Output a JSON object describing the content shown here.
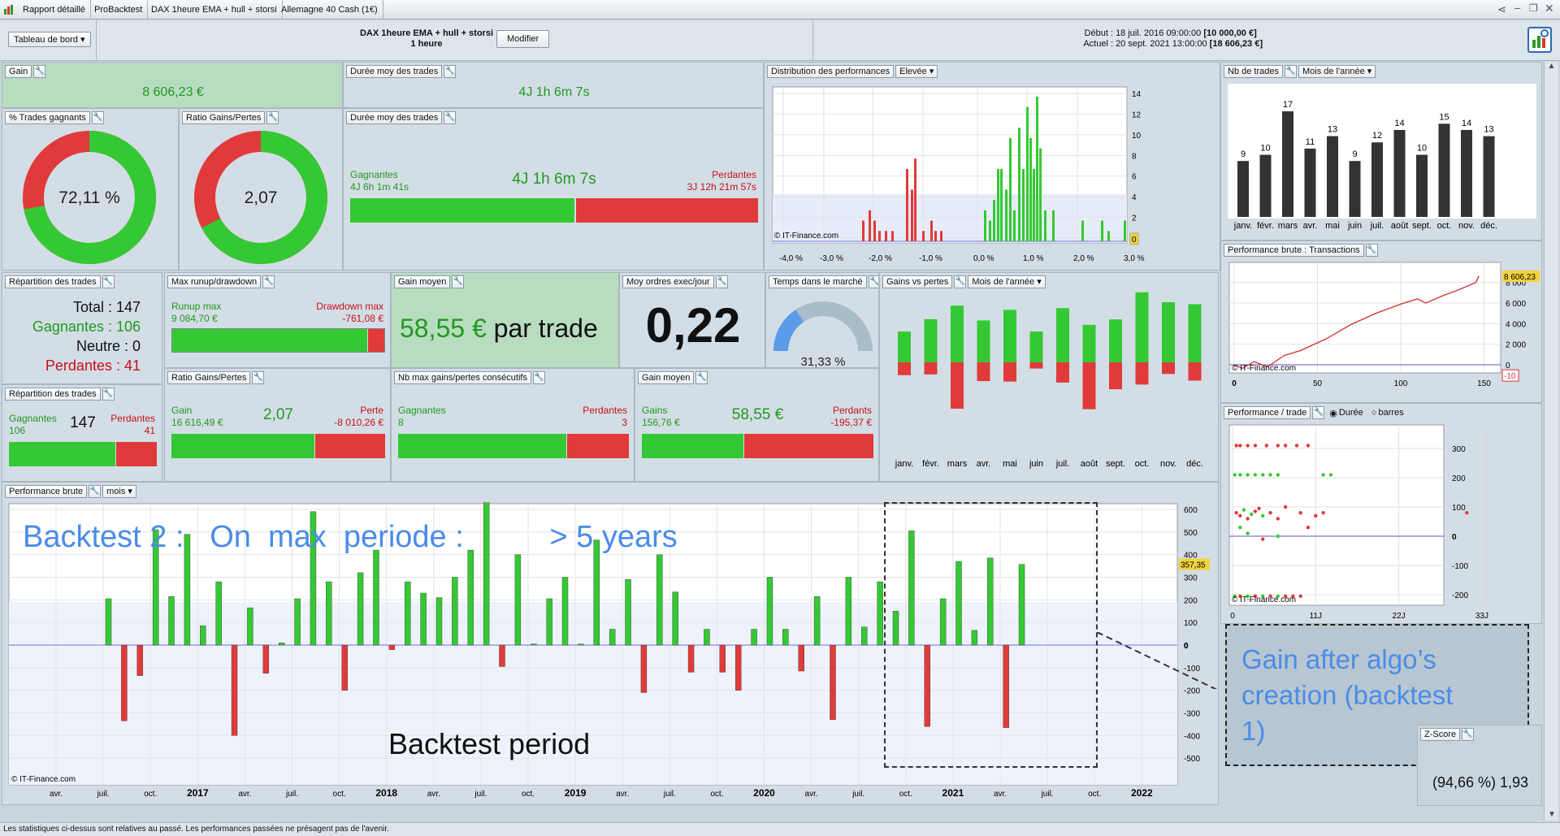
{
  "tabs": [
    "Rapport détaillé",
    "ProBacktest",
    "DAX 1heure EMA + hull + storsi",
    "Allemagne 40 Cash (1€)"
  ],
  "toolbar": {
    "dashboard": "Tableau de bord",
    "strategy_name": "DAX 1heure EMA + hull + storsi",
    "timeframe": "1 heure",
    "modify": "Modifier",
    "start_label": "Début :",
    "start_date": "18 juil. 2016 09:00:00",
    "start_value": "[10 000,00 €]",
    "current_label": "Actuel :",
    "current_date": "20 sept. 2021 13:00:00",
    "current_value": "[18 606,23 €]"
  },
  "gain": {
    "title": "Gain",
    "value": "8 606,23 €"
  },
  "avg_duration_top": {
    "title": "Durée moy des trades",
    "value": "4J 1h 6m 7s"
  },
  "win_pct": {
    "title": "% Trades gagnants",
    "value": "72,11 %",
    "fraction": 0.7211
  },
  "ratio_donut": {
    "title": "Ratio Gains/Pertes",
    "value": "2,07",
    "fraction": 0.674
  },
  "avg_duration": {
    "title": "Durée moy des trades",
    "win_label": "Gagnantes",
    "win_value": "4J 6h 1m 41s",
    "center": "4J 1h 6m 7s",
    "loss_label": "Perdantes",
    "loss_value": "3J 12h 21m 57s",
    "win_fraction": 0.55
  },
  "distribution": {
    "title": "Distribution des performances",
    "dropdown": "Elevée",
    "credit": "© IT-Finance.com",
    "x_ticks": [
      "-4,0 %",
      "-3,0 %",
      "-2,0 %",
      "-1,0 %",
      "0,0 %",
      "1,0 %",
      "2,0 %",
      "3,0 %"
    ],
    "y_ticks": [
      "14",
      "12",
      "10",
      "8",
      "6",
      "4",
      "2",
      "0"
    ],
    "marker": "0"
  },
  "trades_per_month": {
    "title": "Nb de trades",
    "dropdown": "Mois de l'année",
    "labels": [
      "9",
      "10",
      "17",
      "11",
      "13",
      "9",
      "12",
      "14",
      "10",
      "15",
      "14",
      "13"
    ],
    "months": [
      "janv.",
      "févr.",
      "mars",
      "avr.",
      "mai",
      "juin",
      "juil.",
      "août",
      "sept.",
      "oct.",
      "nov.",
      "déc."
    ],
    "values": [
      9,
      10,
      17,
      11,
      13,
      9,
      12,
      14,
      10,
      15,
      14,
      13
    ]
  },
  "equity": {
    "title": "Performance brute : Transactions",
    "credit": "© IT-Finance.com",
    "last_value": "8 606,23",
    "min_marker": "-10",
    "y_ticks": [
      "8 000",
      "6 000",
      "4 000",
      "2 000",
      "0"
    ],
    "x_ticks": [
      "0",
      "50",
      "100",
      "150"
    ]
  },
  "repartition": {
    "title": "Répartition des trades",
    "total": "Total : 147",
    "winners": "Gagnantes : 106",
    "neutral": "Neutre : 0",
    "losers": "Perdantes : 41"
  },
  "runup": {
    "title": "Max runup/drawdown",
    "runup_label": "Runup max",
    "runup_value": "9 084,70 €",
    "dd_label": "Drawdown max",
    "dd_value": "-761,08 €",
    "fraction": 0.92
  },
  "avg_gain_big": {
    "title": "Gain moyen",
    "value": "58,55 €",
    "suffix": "par trade"
  },
  "avg_orders": {
    "title": "Moy ordres exec/jour",
    "value": "0,22"
  },
  "market_time": {
    "title": "Temps dans le marché",
    "value": "31,33 %",
    "fraction": 0.3133
  },
  "gains_vs_losses": {
    "title": "Gains vs pertes",
    "dropdown": "Mois de l'année",
    "months": [
      "janv.",
      "févr.",
      "mars",
      "avr.",
      "mai",
      "juin",
      "juil.",
      "août",
      "sept.",
      "oct.",
      "nov.",
      "déc."
    ],
    "gains": [
      1250,
      1750,
      2300,
      1700,
      2130,
      1250,
      2200,
      1520,
      1740,
      2840,
      2440,
      2360
    ],
    "losses": [
      -520,
      -490,
      -1880,
      -760,
      -780,
      -250,
      -820,
      -1900,
      -1090,
      -900,
      -470,
      -740
    ]
  },
  "repartition2": {
    "title": "Répartition des trades",
    "win_label": "Gagnantes",
    "win_value": "106",
    "total": "147",
    "loss_label": "Perdantes",
    "loss_value": "41",
    "fraction": 0.7211
  },
  "ratio_bar": {
    "title": "Ratio Gains/Pertes",
    "gain_label": "Gain",
    "gain_value": "16 616,49 €",
    "center": "2,07",
    "loss_label": "Perte",
    "loss_value": "-8 010,26 €",
    "fraction": 0.67
  },
  "consecutive": {
    "title": "Nb max gains/pertes consécutifs",
    "win_label": "Gagnantes",
    "win_value": "8",
    "loss_label": "Perdantes",
    "loss_value": "3",
    "fraction": 0.73
  },
  "avg_gain_bar": {
    "title": "Gain moyen",
    "win_label": "Gains",
    "win_value": "156,76 €",
    "center": "58,55 €",
    "loss_label": "Perdants",
    "loss_value": "-195,37 €",
    "fraction": 0.44
  },
  "perf_per_trade": {
    "title": "Performance / trade",
    "opt1": "Durée",
    "opt2": "barres",
    "credit": "© IT-Finance.com",
    "y_ticks": [
      "300",
      "200",
      "100",
      "0",
      "-100",
      "-200"
    ],
    "x_ticks": [
      "0",
      "11J",
      "22J",
      "33J"
    ]
  },
  "perf_brute": {
    "title": "Performance brute",
    "dropdown": "mois",
    "credit": "© IT-Finance.com",
    "last_value": "357,35",
    "zero_marker": "0",
    "y_ticks": [
      "700",
      "600",
      "500",
      "400",
      "300",
      "200",
      "100",
      "0",
      "-100",
      "-200",
      "-300",
      "-400",
      "-500"
    ],
    "x_ticks": [
      "avr.",
      "juil.",
      "oct.",
      "2017",
      "avr.",
      "juil.",
      "oct.",
      "2018",
      "avr.",
      "juil.",
      "oct.",
      "2019",
      "avr.",
      "juil.",
      "oct.",
      "2020",
      "avr.",
      "juil.",
      "oct.",
      "2021",
      "avr.",
      "juil.",
      "oct.",
      "2022"
    ],
    "values": [
      205,
      -335,
      -135,
      510,
      215,
      490,
      85,
      280,
      -400,
      165,
      -125,
      10,
      205,
      590,
      280,
      -200,
      320,
      420,
      -20,
      280,
      230,
      210,
      300,
      420,
      630,
      -95,
      400,
      5,
      205,
      300,
      5,
      465,
      70,
      290,
      -210,
      400,
      235,
      -120,
      70,
      -120,
      -200,
      70,
      300,
      70,
      -115,
      215,
      -330,
      300,
      80,
      280,
      150,
      505,
      -360,
      205,
      370,
      65,
      385,
      -365,
      357
    ]
  },
  "zscore": {
    "title": "Z-Score",
    "value": "(94,66 %) 1,93"
  },
  "annotations": {
    "backtest2": "Backtest 2 :   On  max  periode :          > 5 years",
    "backtest_period": "Backtest period",
    "gain_after": "Gain after algo’s creation (backtest 1)"
  },
  "footer": "Les statistiques ci-dessus sont relatives au passé. Les performances passées ne présagent pas de l'avenir.",
  "colors": {
    "green": "#34c934",
    "red": "#e13a3a",
    "panel": "#d3dde5",
    "annotation": "#4a8ce8"
  }
}
